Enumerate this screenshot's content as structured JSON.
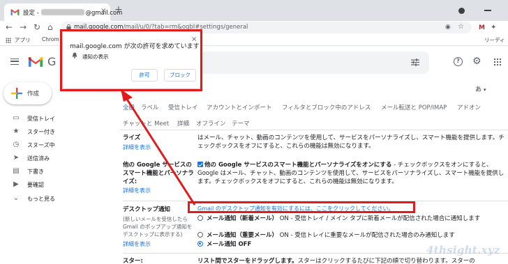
{
  "browser": {
    "tab": {
      "title_prefix": "設定 - ",
      "title_suffix": "@gmail.com",
      "close": "×"
    },
    "new_tab": "+",
    "toolbar": {
      "back": "←",
      "forward": "→",
      "reload": "↻",
      "home": "⌂",
      "star": "☆",
      "eye": "◉"
    },
    "url": {
      "host": "mail.google.com",
      "path": "/mail/u/0/?tab=rm&ogbl#settings/general"
    },
    "bookmarks": [
      {
        "label": "アプリ"
      },
      {
        "label": "Chrom"
      }
    ],
    "reading_list": "リーディ",
    "extension_gmail": "M"
  },
  "gmail": {
    "wordmark": "G",
    "compose": {
      "label": "作成"
    },
    "nav": [
      {
        "label": "受信トレイ",
        "icon": "inbox-icon",
        "glyph": "▭"
      },
      {
        "label": "スター付き",
        "icon": "star-icon",
        "glyph": "★"
      },
      {
        "label": "スヌーズ中",
        "icon": "clock-icon",
        "glyph": "◷"
      },
      {
        "label": "送信済み",
        "icon": "send-icon",
        "glyph": "➤"
      },
      {
        "label": "下書き",
        "icon": "draft-icon",
        "glyph": "▤"
      },
      {
        "label": "要確認",
        "icon": "label-icon",
        "glyph": "▶"
      },
      {
        "label": "もっと見る",
        "icon": "chevron-down-icon",
        "glyph": "⌄"
      }
    ],
    "header": {
      "help": "?",
      "gear": "⚙"
    },
    "lang": {
      "label": "あ",
      "caret": "▾"
    }
  },
  "settings": {
    "tabs_row1": [
      "全般",
      "ラベル",
      "受信トレイ",
      "アカウントとインポート",
      "フィルタとブロック中のアドレス",
      "メール転送と POP/IMAP",
      "アドオン"
    ],
    "tabs_row2": [
      "チャットと Meet",
      "詳細",
      "オフライン",
      "テーマ"
    ],
    "personalize": {
      "label": "ライズ",
      "link": "詳細を表示",
      "desc": "はメール、チャット、動画のコンテンツを使用して、サービスをパーソナライズし、スマート機能を提供します。チェックボックスをオフにすると、これらの機能は無効になります。"
    },
    "other_services": {
      "label": "他の Google サービスのスマート機能とパーソナライズ:",
      "link": "詳細を表示",
      "desc_bold": "他の Google サービスのスマート機能とパーソナライズをオンにする",
      "desc": " - チェックボックスをオンにすると、Google はメール、チャット、動画のコンテンツを使用して、サービスをパーソナライズし、スマート機能を提供します。チェックボックスをオフにすると、これらの機能は無効になります。"
    },
    "desktop_notifications": {
      "label": "デスクトップ通知",
      "sub": "(新しいメールを受信したら Gmail のポップアップ通知をデスクトップに表示する)",
      "link": "詳細を表示",
      "enable_link": "Gmail のデスクトップ通知を有効にするには、ここをクリックしてください。",
      "options": [
        {
          "bold": "メール通知（新着メール）",
          "rest": " ON - 受信トレイ / メイン タブに新着メールが配信された場合に通知します"
        },
        {
          "bold": "メール通知（重要メール）",
          "rest": " ON - 受信トレイに重要なメールが配信された場合のみ通知します"
        },
        {
          "bold": "メール通知 OFF",
          "rest": ""
        }
      ],
      "selected_option": 2
    },
    "stars": {
      "label": "スター:",
      "desc_bold": "リスト間でスターをドラッグします。",
      "desc": "スターはクリックするたびに下記の順で切り替わります。スターの"
    }
  },
  "prompt": {
    "title": "mail.google.com が次の許可を求めています",
    "item": "通知の表示",
    "allow": "許可",
    "block": "ブロック",
    "close": "×"
  },
  "watermark": "4thsight.xyz",
  "colors": {
    "highlight": "#e11b1b",
    "link": "#1a73e8",
    "gmail_red": "#ea4335"
  }
}
